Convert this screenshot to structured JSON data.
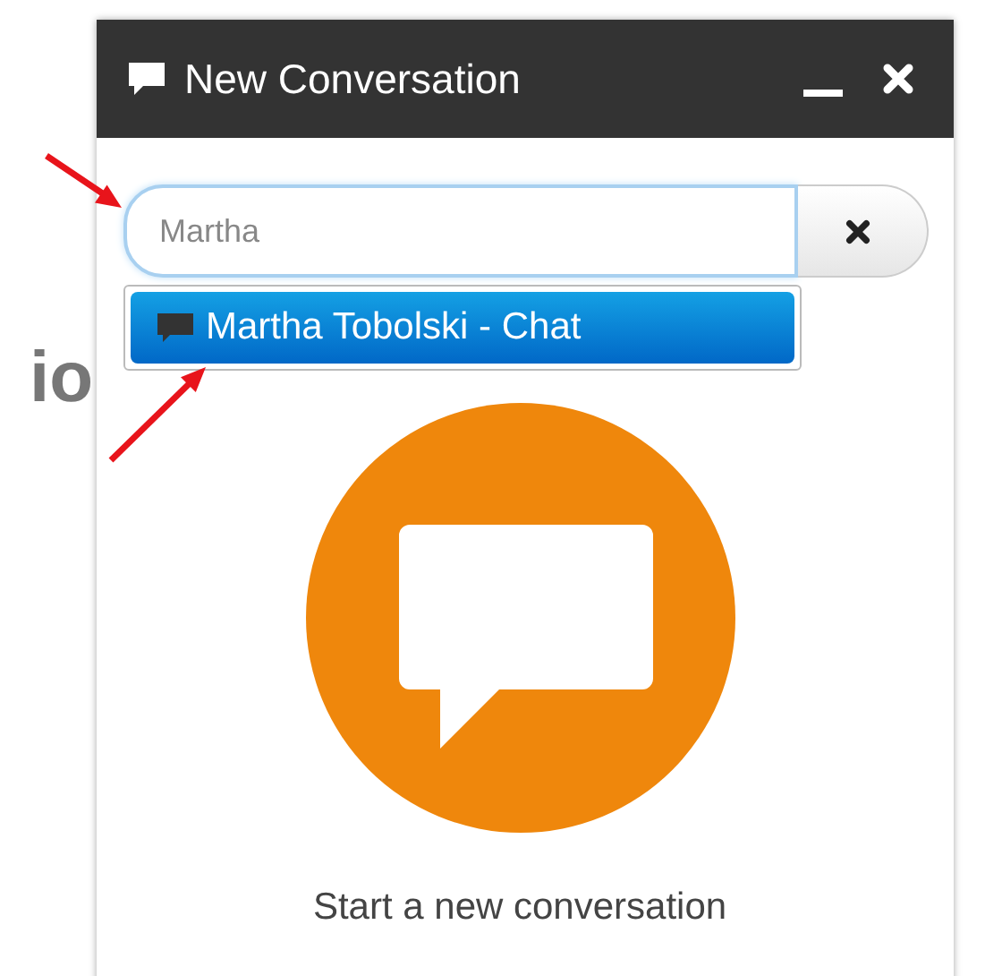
{
  "background_text": "io",
  "window": {
    "title": "New Conversation"
  },
  "search": {
    "value": "Martha"
  },
  "suggestions": [
    {
      "label": "Martha Tobolski - Chat",
      "selected": true
    }
  ],
  "empty_state": {
    "message": "Start a new conversation"
  }
}
